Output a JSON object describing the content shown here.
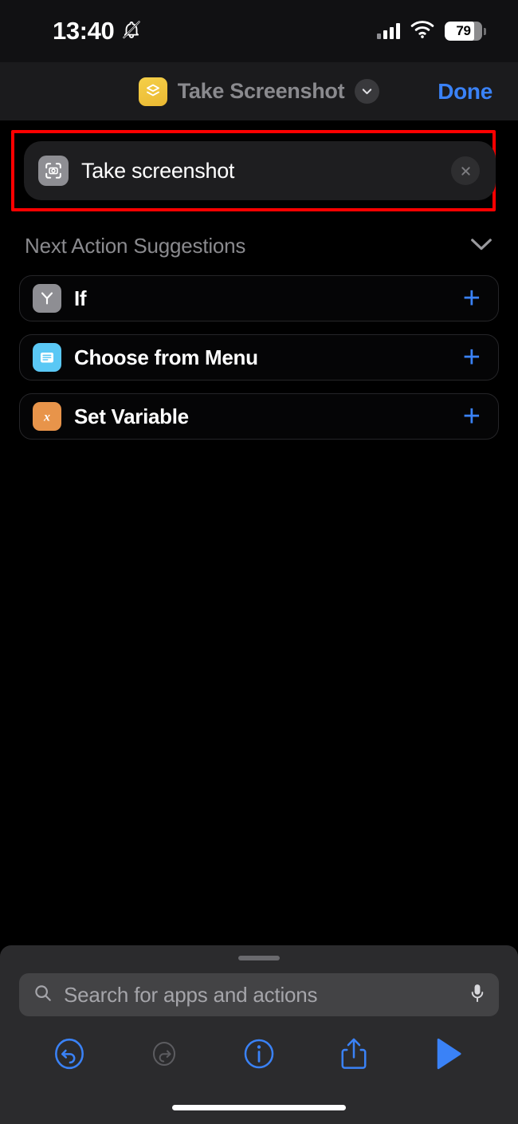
{
  "status_bar": {
    "time": "13:40",
    "silent_icon": "bell-slash-icon",
    "signal_icon": "cellular-signal-icon",
    "signal_bars_active": 3,
    "wifi_icon": "wifi-icon",
    "battery_percent": "79",
    "battery_level": 79
  },
  "navbar": {
    "app_icon": "shortcuts-layers-icon",
    "title": "Take Screenshot",
    "chevron_icon": "chevron-down-icon",
    "done_label": "Done"
  },
  "action": {
    "icon": "screenshot-camera-icon",
    "label": "Take screenshot",
    "delete_icon": "close-circle-icon",
    "highlight_color": "#ff0000"
  },
  "suggestions": {
    "header": "Next Action Suggestions",
    "collapse_icon": "chevron-down-icon",
    "items": [
      {
        "label": "If",
        "icon": "branch-icon",
        "icon_color": "#8e8e93",
        "add_icon": "plus-icon"
      },
      {
        "label": "Choose from Menu",
        "icon": "menu-list-icon",
        "icon_color": "#5ac8f5",
        "add_icon": "plus-icon"
      },
      {
        "label": "Set Variable",
        "icon": "variable-x-icon",
        "icon_color": "#e8944a",
        "add_icon": "plus-icon"
      }
    ]
  },
  "sheet": {
    "grabber": "drag-handle",
    "search": {
      "icon": "search-icon",
      "placeholder": "Search for apps and actions",
      "value": "",
      "mic_icon": "microphone-icon"
    }
  },
  "toolbar": {
    "items": [
      {
        "name": "undo-button",
        "icon": "undo-icon",
        "enabled": true
      },
      {
        "name": "redo-button",
        "icon": "redo-icon",
        "enabled": false
      },
      {
        "name": "info-button",
        "icon": "info-icon",
        "enabled": true
      },
      {
        "name": "share-button",
        "icon": "share-icon",
        "enabled": true
      },
      {
        "name": "run-button",
        "icon": "play-icon",
        "enabled": true
      }
    ]
  },
  "colors": {
    "accent_blue": "#3a82f7",
    "disabled_gray": "#6a6a6e",
    "background": "#000000",
    "card": "#1e1e20"
  }
}
